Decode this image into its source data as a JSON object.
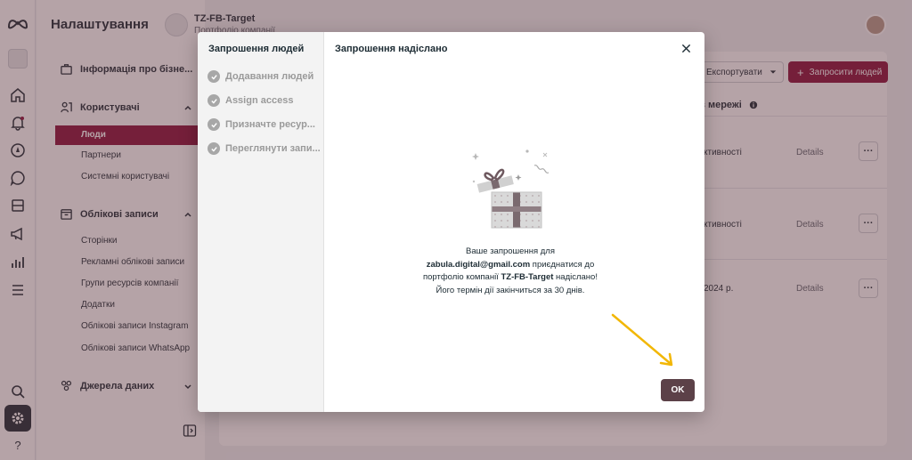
{
  "app": {
    "page_title": "Налаштування",
    "business_name": "TZ-FB-Target",
    "business_subtitle": "Портфоліо компанії"
  },
  "sidebar": {
    "sections": [
      {
        "label": "Інформація про бізне..."
      },
      {
        "label": "Користувачі",
        "items": [
          "Люди",
          "Партнери",
          "Системні користувачі"
        ]
      },
      {
        "label": "Облікові записи",
        "items": [
          "Сторінки",
          "Рекламні облікові записи",
          "Групи ресурсів компанії",
          "Додатки",
          "Облікові записи Instagram",
          "Облікові записи WhatsApp"
        ]
      },
      {
        "label": "Джерела даних"
      }
    ],
    "active_item": "Люди"
  },
  "main": {
    "export_label": "Експортувати",
    "invite_label": "Запросити людей",
    "column_header": "є в мережі",
    "rows": [
      {
        "status": "ктивності",
        "details": "Details"
      },
      {
        "status": "ктивності",
        "details": "Details"
      },
      {
        "status": "2024 р.",
        "details": "Details"
      }
    ]
  },
  "modal": {
    "steps_title": "Запрошення людей",
    "steps": [
      "Додавання людей",
      "Assign access",
      "Призначте ресур...",
      "Переглянути запи..."
    ],
    "title": "Запрошення надіслано",
    "message_line1": "Ваше запрошення для",
    "email": "zabula.digital@gmail.com",
    "message_line2": " приєднатися до",
    "message_line3": "портфоліо компанії ",
    "business": "TZ-FB-Target",
    "message_line4": " надіслано!",
    "message_line5": "Його термін дії закінчиться за 30 днів.",
    "ok_label": "OK"
  },
  "colors": {
    "accent": "#8b0f3a",
    "overlay": "#5c343c",
    "ok_button": "#5c4148",
    "annotation_arrow": "#f2b705"
  },
  "icons": {
    "rail": [
      "meta-logo-icon",
      "business-avatar-icon",
      "home-icon",
      "notifications-icon",
      "compass-icon",
      "chat-icon",
      "pages-icon",
      "megaphone-icon",
      "insights-icon",
      "menu-icon",
      "search-icon",
      "settings-icon",
      "help-icon"
    ]
  }
}
